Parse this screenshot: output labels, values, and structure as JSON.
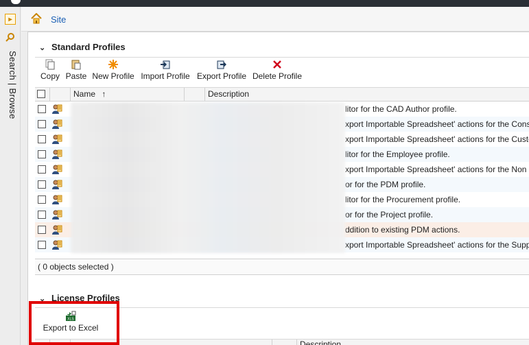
{
  "breadcrumb": {
    "site_label": "Site"
  },
  "rail": {
    "label": "Search | Browse"
  },
  "standard_profiles": {
    "title": "Standard Profiles",
    "toolbar": {
      "copy": "Copy",
      "paste": "Paste",
      "new_profile": "New Profile",
      "import_profile": "Import Profile",
      "export_profile": "Export Profile",
      "delete_profile": "Delete Profile"
    },
    "columns": {
      "name": "Name",
      "sort_indicator": "↑",
      "description": "Description"
    },
    "rows": [
      {
        "description": "litor for the CAD Author profile."
      },
      {
        "description": "xport Importable Spreadsheet' actions for the Cons"
      },
      {
        "description": "xport Importable Spreadsheet' actions for the Custo"
      },
      {
        "description": "litor for the Employee profile."
      },
      {
        "description": "xport Importable Spreadsheet' actions for the Non"
      },
      {
        "description": "or for the PDM profile."
      },
      {
        "description": "litor for the Procurement profile."
      },
      {
        "description": "or for the Project profile."
      },
      {
        "description": "ddition to existing PDM actions."
      },
      {
        "description": "xport Importable Spreadsheet' actions for the Supp"
      }
    ],
    "status": "( 0 objects selected )"
  },
  "license_profiles": {
    "title": "License Profiles",
    "toolbar": {
      "export_to_excel": "Export to Excel",
      "xls_badge": "XLS"
    },
    "columns": {
      "description": "Description"
    }
  },
  "colors": {
    "accent_link": "#1a5fb4",
    "highlight_box": "#e00000",
    "delete_red": "#d0021b"
  }
}
